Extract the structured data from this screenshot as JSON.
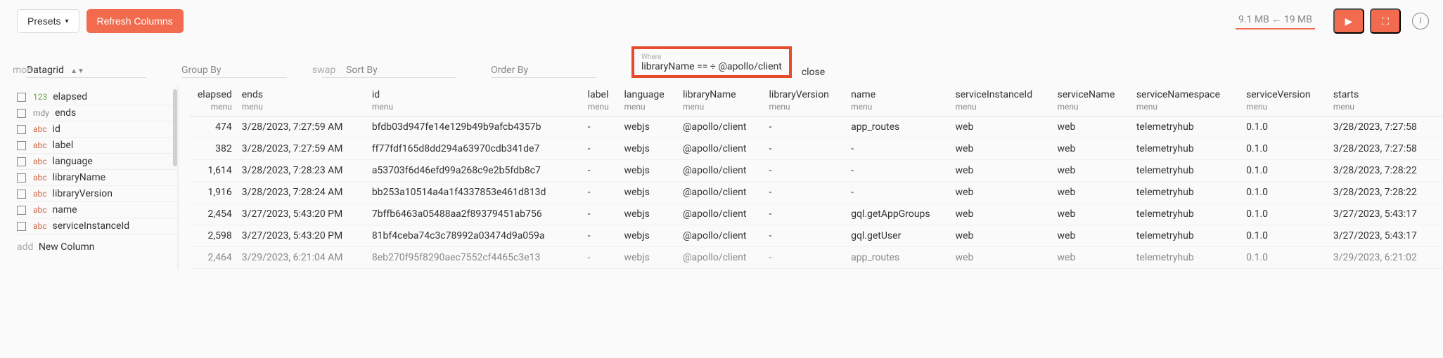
{
  "toolbar": {
    "presets_label": "Presets",
    "refresh_label": "Refresh Columns",
    "memory_status": "9.1 MB ← 19 MB"
  },
  "controls": {
    "mon_ghost": "mon",
    "datagrid_label": "Datagrid",
    "groupby_placeholder": "Group By",
    "swap_ghost": "swap",
    "sortby_placeholder": "Sort By",
    "orderby_placeholder": "Order By",
    "where_label": "Where",
    "where_value": "libraryName == ÷ @apollo/client",
    "close_label": "close"
  },
  "sidebar": {
    "items": [
      {
        "type": "123",
        "cls": "t-num",
        "label": "elapsed"
      },
      {
        "type": "mdy",
        "cls": "t-mdy",
        "label": "ends"
      },
      {
        "type": "abc",
        "cls": "t-abc",
        "label": "id"
      },
      {
        "type": "abc",
        "cls": "t-abc",
        "label": "label"
      },
      {
        "type": "abc",
        "cls": "t-abc",
        "label": "language"
      },
      {
        "type": "abc",
        "cls": "t-abc",
        "label": "libraryName"
      },
      {
        "type": "abc",
        "cls": "t-abc",
        "label": "libraryVersion"
      },
      {
        "type": "abc",
        "cls": "t-abc",
        "label": "name"
      },
      {
        "type": "abc",
        "cls": "t-abc",
        "label": "serviceInstanceId"
      }
    ],
    "add_ghost": "add",
    "add_label": "New Column"
  },
  "grid": {
    "menu_label": "menu",
    "columns": [
      {
        "key": "elapsed",
        "label": "elapsed",
        "numeric": true
      },
      {
        "key": "ends",
        "label": "ends"
      },
      {
        "key": "id",
        "label": "id"
      },
      {
        "key": "label",
        "label": "label"
      },
      {
        "key": "language",
        "label": "language"
      },
      {
        "key": "libraryName",
        "label": "libraryName"
      },
      {
        "key": "libraryVersion",
        "label": "libraryVersion"
      },
      {
        "key": "name",
        "label": "name"
      },
      {
        "key": "serviceInstanceId",
        "label": "serviceInstanceId"
      },
      {
        "key": "serviceName",
        "label": "serviceName"
      },
      {
        "key": "serviceNamespace",
        "label": "serviceNamespace"
      },
      {
        "key": "serviceVersion",
        "label": "serviceVersion"
      },
      {
        "key": "starts",
        "label": "starts"
      }
    ],
    "rows": [
      {
        "elapsed": "474",
        "ends": "3/28/2023, 7:27:59 AM",
        "id": "bfdb03d947fe14e129b49b9afcb4357b",
        "label": "-",
        "language": "webjs",
        "libraryName": "@apollo/client",
        "libraryVersion": "-",
        "name": "app_routes",
        "serviceInstanceId": "web",
        "serviceName": "web",
        "serviceNamespace": "telemetryhub",
        "serviceVersion": "0.1.0",
        "starts": "3/28/2023, 7:27:58"
      },
      {
        "elapsed": "382",
        "ends": "3/28/2023, 7:27:59 AM",
        "id": "ff77fdf165d8dd294a63970cdb341de7",
        "label": "-",
        "language": "webjs",
        "libraryName": "@apollo/client",
        "libraryVersion": "-",
        "name": "-",
        "serviceInstanceId": "web",
        "serviceName": "web",
        "serviceNamespace": "telemetryhub",
        "serviceVersion": "0.1.0",
        "starts": "3/28/2023, 7:27:58"
      },
      {
        "elapsed": "1,614",
        "ends": "3/28/2023, 7:28:23 AM",
        "id": "a53703f6d46efd99a268c9e2b5fdb8c7",
        "label": "-",
        "language": "webjs",
        "libraryName": "@apollo/client",
        "libraryVersion": "-",
        "name": "-",
        "serviceInstanceId": "web",
        "serviceName": "web",
        "serviceNamespace": "telemetryhub",
        "serviceVersion": "0.1.0",
        "starts": "3/28/2023, 7:28:22"
      },
      {
        "elapsed": "1,916",
        "ends": "3/28/2023, 7:28:24 AM",
        "id": "bb253a10514a4a1f4337853e461d813d",
        "label": "-",
        "language": "webjs",
        "libraryName": "@apollo/client",
        "libraryVersion": "-",
        "name": "-",
        "serviceInstanceId": "web",
        "serviceName": "web",
        "serviceNamespace": "telemetryhub",
        "serviceVersion": "0.1.0",
        "starts": "3/28/2023, 7:28:22"
      },
      {
        "elapsed": "2,454",
        "ends": "3/27/2023, 5:43:20 PM",
        "id": "7bffb6463a05488aa2f89379451ab756",
        "label": "-",
        "language": "webjs",
        "libraryName": "@apollo/client",
        "libraryVersion": "-",
        "name": "gql.getAppGroups",
        "serviceInstanceId": "web",
        "serviceName": "web",
        "serviceNamespace": "telemetryhub",
        "serviceVersion": "0.1.0",
        "starts": "3/27/2023, 5:43:17"
      },
      {
        "elapsed": "2,598",
        "ends": "3/27/2023, 5:43:20 PM",
        "id": "81bf4ceba74c3c78992a03474d9a059a",
        "label": "-",
        "language": "webjs",
        "libraryName": "@apollo/client",
        "libraryVersion": "-",
        "name": "gql.getUser",
        "serviceInstanceId": "web",
        "serviceName": "web",
        "serviceNamespace": "telemetryhub",
        "serviceVersion": "0.1.0",
        "starts": "3/27/2023, 5:43:17"
      },
      {
        "elapsed": "2,464",
        "ends": "3/29/2023, 6:21:04 AM",
        "id": "8eb270f95f8290aec7552cf4465c3e13",
        "label": "-",
        "language": "webjs",
        "libraryName": "@apollo/client",
        "libraryVersion": "-",
        "name": "app_routes",
        "serviceInstanceId": "web",
        "serviceName": "web",
        "serviceNamespace": "telemetryhub",
        "serviceVersion": "0.1.0",
        "starts": "3/29/2023, 6:21:02",
        "faded": true
      }
    ]
  }
}
